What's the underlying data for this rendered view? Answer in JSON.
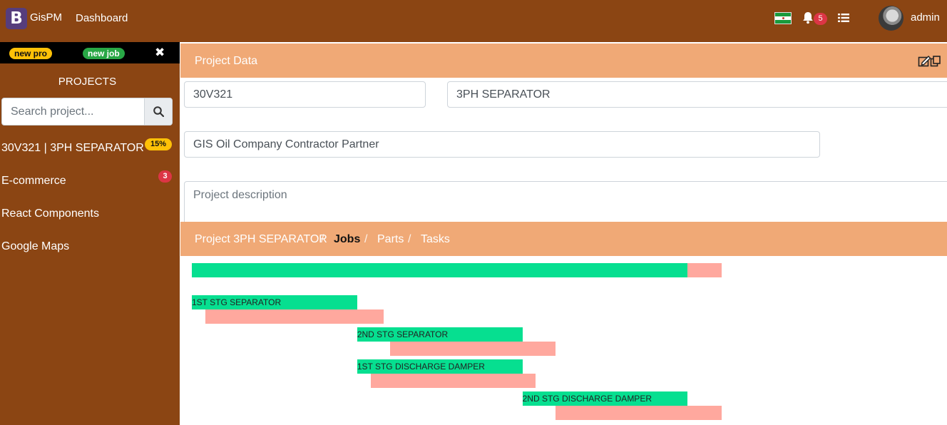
{
  "navbar": {
    "brand_letter": "B",
    "brand_name": "GisPM",
    "dashboard_label": "Dashboard",
    "notifications_count": "5",
    "user_name": "admin",
    "icons": [
      "flag-icon",
      "bell-icon",
      "list-icon"
    ],
    "color": "#8b4513"
  },
  "sidebar": {
    "new_pro_label": "new pro",
    "new_job_label": "new job",
    "close_label": "✖",
    "title": "PROJECTS",
    "search_placeholder": "Search project...",
    "items": [
      {
        "label": "30V321 | 3PH SEPARATOR",
        "badge": "15%"
      },
      {
        "label": "E-commerce",
        "badge": "3"
      },
      {
        "label": "React Components",
        "badge": ""
      },
      {
        "label": "Google Maps",
        "badge": ""
      }
    ]
  },
  "project": {
    "header_title": "Project Data",
    "code": "30V321",
    "name": "3PH SEPARATOR",
    "client": "GIS Oil Company Contractor Partner",
    "description_placeholder": "Project description",
    "accent_color": "#f0a976"
  },
  "breadcrumb": {
    "items": [
      "Project 3PH SEPARATOR",
      "Jobs",
      "Parts",
      "Tasks"
    ],
    "separator": "/",
    "active": "Jobs"
  },
  "gantt": {
    "plan_color": "#06df90",
    "actual_color": "#ffa89e",
    "tasks": [
      {
        "name": "",
        "plan_start": 0.0,
        "plan_end": 0.936,
        "actual_start": 0.936,
        "actual_end": 1.0
      },
      {
        "name": "1ST STG SEPARATOR",
        "plan_start": 0.0,
        "plan_end": 0.312,
        "actual_start": 0.026,
        "actual_end": 0.362
      },
      {
        "name": "2ND STG SEPARATOR",
        "plan_start": 0.312,
        "plan_end": 0.624,
        "actual_start": 0.374,
        "actual_end": 0.687
      },
      {
        "name": "1ST STG DISCHARGE DAMPER",
        "plan_start": 0.312,
        "plan_end": 0.624,
        "actual_start": 0.338,
        "actual_end": 0.649
      },
      {
        "name": "2ND STG DISCHARGE DAMPER",
        "plan_start": 0.624,
        "plan_end": 0.936,
        "actual_start": 0.687,
        "actual_end": 1.0
      }
    ]
  }
}
